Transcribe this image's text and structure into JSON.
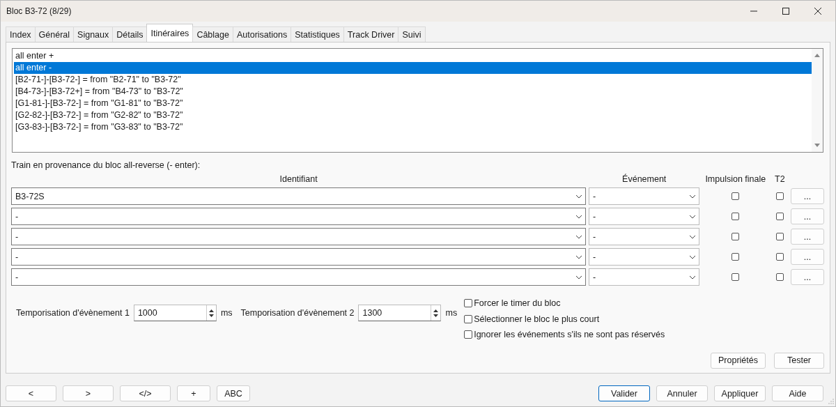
{
  "window": {
    "title": "Bloc B3-72 (8/29)"
  },
  "tabs": [
    {
      "label": "Index",
      "selected": false
    },
    {
      "label": "Général",
      "selected": false
    },
    {
      "label": "Signaux",
      "selected": false
    },
    {
      "label": "Détails",
      "selected": false
    },
    {
      "label": "Itinéraires",
      "selected": true
    },
    {
      "label": "Câblage",
      "selected": false
    },
    {
      "label": "Autorisations",
      "selected": false
    },
    {
      "label": "Statistiques",
      "selected": false
    },
    {
      "label": "Track Driver",
      "selected": false
    },
    {
      "label": "Suivi",
      "selected": false
    }
  ],
  "routes": [
    {
      "label": "all enter +",
      "selected": false
    },
    {
      "label": "all enter -",
      "selected": true
    },
    {
      "label": "[B2-71-]-[B3-72-] = from \"B2-71\" to \"B3-72\"",
      "selected": false
    },
    {
      "label": "[B4-73-]-[B3-72+] = from \"B4-73\" to \"B3-72\"",
      "selected": false
    },
    {
      "label": "[G1-81-]-[B3-72-] = from \"G1-81\" to \"B3-72\"",
      "selected": false
    },
    {
      "label": "[G2-82-]-[B3-72-] = from \"G2-82\" to \"B3-72\"",
      "selected": false
    },
    {
      "label": "[G3-83-]-[B3-72-] = from \"G3-83\" to \"B3-72\"",
      "selected": false
    }
  ],
  "section_label": "Train en provenance du bloc all-reverse (- enter):",
  "columns": {
    "identifiant": "Identifiant",
    "evenement": "Événement",
    "impulsion": "Impulsion finale",
    "t2": "T2"
  },
  "rows": [
    {
      "identifiant": "B3-72S",
      "evenement": "-",
      "impulsion": false,
      "t2": false,
      "button": "..."
    },
    {
      "identifiant": "-",
      "evenement": "-",
      "impulsion": false,
      "t2": false,
      "button": "..."
    },
    {
      "identifiant": "-",
      "evenement": "-",
      "impulsion": false,
      "t2": false,
      "button": "..."
    },
    {
      "identifiant": "-",
      "evenement": "-",
      "impulsion": false,
      "t2": false,
      "button": "..."
    },
    {
      "identifiant": "-",
      "evenement": "-",
      "impulsion": false,
      "t2": false,
      "button": "..."
    }
  ],
  "timers": [
    {
      "label": "Temporisation d'évènement 1",
      "value": "1000",
      "unit": "ms"
    },
    {
      "label": "Temporisation d'évènement 2",
      "value": "1300",
      "unit": "ms"
    }
  ],
  "options": [
    {
      "label": "Forcer le timer du bloc",
      "checked": false
    },
    {
      "label": "Sélectionner le bloc le plus court",
      "checked": false
    },
    {
      "label": "Ignorer les événements s'ils ne sont pas réservés",
      "checked": false
    }
  ],
  "panel_buttons": [
    "Propriétés",
    "Tester"
  ],
  "nav_buttons": [
    "<",
    ">",
    "</>",
    "+",
    "ABC"
  ],
  "dialog_buttons": [
    {
      "label": "Valider",
      "default": true
    },
    {
      "label": "Annuler",
      "default": false
    },
    {
      "label": "Appliquer",
      "default": false
    },
    {
      "label": "Aide",
      "default": false
    }
  ]
}
